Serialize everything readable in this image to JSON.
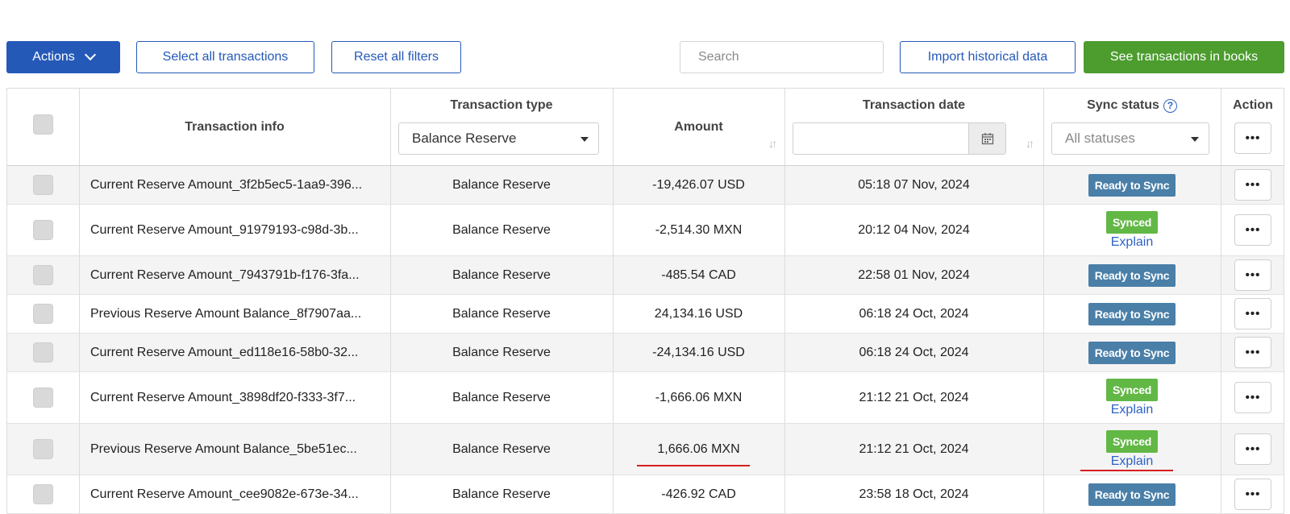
{
  "toolbar": {
    "actions_label": "Actions",
    "select_all_label": "Select all transactions",
    "reset_filters_label": "Reset all filters",
    "search_placeholder": "Search",
    "import_label": "Import historical data",
    "see_books_label": "See transactions in books"
  },
  "table": {
    "headers": {
      "info": "Transaction info",
      "type": "Transaction type",
      "amount": "Amount",
      "date": "Transaction date",
      "sync": "Sync status",
      "action": "Action"
    },
    "filters": {
      "type_selected": "Balance Reserve",
      "sync_selected": "All statuses",
      "date_value": ""
    },
    "rows": [
      {
        "info": "Current Reserve Amount_3f2b5ec5-1aa9-396...",
        "type": "Balance Reserve",
        "amount": "-19,426.07 USD",
        "date": "05:18 07 Nov, 2024",
        "status": "Ready to Sync",
        "explain": ""
      },
      {
        "info": "Current Reserve Amount_91979193-c98d-3b...",
        "type": "Balance Reserve",
        "amount": "-2,514.30 MXN",
        "date": "20:12 04 Nov, 2024",
        "status": "Synced",
        "explain": "Explain"
      },
      {
        "info": "Current Reserve Amount_7943791b-f176-3fa...",
        "type": "Balance Reserve",
        "amount": "-485.54 CAD",
        "date": "22:58 01 Nov, 2024",
        "status": "Ready to Sync",
        "explain": ""
      },
      {
        "info": "Previous Reserve Amount Balance_8f7907aa...",
        "type": "Balance Reserve",
        "amount": "24,134.16 USD",
        "date": "06:18 24 Oct, 2024",
        "status": "Ready to Sync",
        "explain": ""
      },
      {
        "info": "Current Reserve Amount_ed118e16-58b0-32...",
        "type": "Balance Reserve",
        "amount": "-24,134.16 USD",
        "date": "06:18 24 Oct, 2024",
        "status": "Ready to Sync",
        "explain": ""
      },
      {
        "info": "Current Reserve Amount_3898df20-f333-3f7...",
        "type": "Balance Reserve",
        "amount": "-1,666.06 MXN",
        "date": "21:12 21 Oct, 2024",
        "status": "Synced",
        "explain": "Explain"
      },
      {
        "info": "Previous Reserve Amount Balance_5be51ec...",
        "type": "Balance Reserve",
        "amount": "1,666.06 MXN",
        "date": "21:12 21 Oct, 2024",
        "status": "Synced",
        "explain": "Explain"
      },
      {
        "info": "Current Reserve Amount_cee9082e-673e-34...",
        "type": "Balance Reserve",
        "amount": "-426.92 CAD",
        "date": "23:58 18 Oct, 2024",
        "status": "Ready to Sync",
        "explain": ""
      }
    ],
    "action_dots": "•••",
    "sort_glyph": "↓↑"
  },
  "colors": {
    "primary": "#2559b8",
    "success": "#4c9c2e",
    "ready_badge": "#4a7fa8",
    "synced_badge": "#62b845",
    "annotation_red": "#d81f1f"
  }
}
